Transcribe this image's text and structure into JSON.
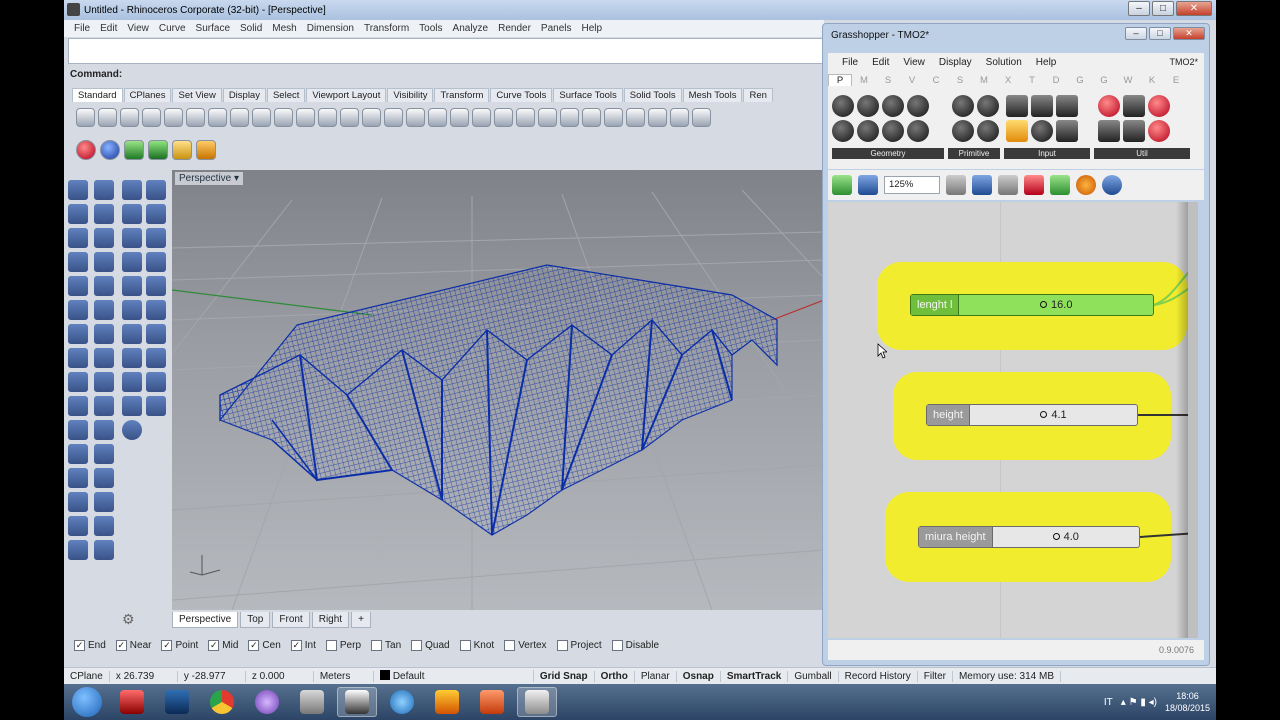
{
  "rhino": {
    "window_title": "Untitled - Rhinoceros Corporate (32-bit) - [Perspective]",
    "menu": [
      "File",
      "Edit",
      "View",
      "Curve",
      "Surface",
      "Solid",
      "Mesh",
      "Dimension",
      "Transform",
      "Tools",
      "Analyze",
      "Render",
      "Panels",
      "Help"
    ],
    "command_label": "Command:",
    "toolbar_tabs": [
      "Standard",
      "CPlanes",
      "Set View",
      "Display",
      "Select",
      "Viewport Layout",
      "Visibility",
      "Transform",
      "Curve Tools",
      "Surface Tools",
      "Solid Tools",
      "Mesh Tools",
      "Ren"
    ],
    "viewport_title": "Perspective",
    "viewport_tabs": [
      "Perspective",
      "Top",
      "Front",
      "Right"
    ],
    "viewport_add_tab": "+",
    "osnaps": [
      {
        "label": "End",
        "checked": true
      },
      {
        "label": "Near",
        "checked": true
      },
      {
        "label": "Point",
        "checked": true
      },
      {
        "label": "Mid",
        "checked": true
      },
      {
        "label": "Cen",
        "checked": true
      },
      {
        "label": "Int",
        "checked": true
      },
      {
        "label": "Perp",
        "checked": false
      },
      {
        "label": "Tan",
        "checked": false
      },
      {
        "label": "Quad",
        "checked": false
      },
      {
        "label": "Knot",
        "checked": false
      },
      {
        "label": "Vertex",
        "checked": false
      },
      {
        "label": "Project",
        "checked": false
      },
      {
        "label": "Disable",
        "checked": false
      }
    ],
    "status": {
      "cplane": "CPlane",
      "x": "x 26.739",
      "y": "y -28.977",
      "z": "z 0.000",
      "units": "Meters",
      "layer": "Default",
      "toggles": [
        "Grid Snap",
        "Ortho",
        "Planar",
        "Osnap",
        "SmartTrack",
        "Gumball",
        "Record History",
        "Filter"
      ],
      "memory": "Memory use: 314 MB"
    }
  },
  "grasshopper": {
    "title": "Grasshopper - TMO2*",
    "menu": [
      "File",
      "Edit",
      "View",
      "Display",
      "Solution",
      "Help"
    ],
    "document": "TMO2*",
    "tabs": [
      "P",
      "M",
      "S",
      "V",
      "C",
      "S",
      "M",
      "X",
      "T",
      "D",
      "G",
      "G",
      "W",
      "K",
      "E"
    ],
    "palette_groups": [
      "Geometry",
      "Primitive",
      "Input",
      "Util"
    ],
    "zoom": "125%",
    "sliders": [
      {
        "name": "lenght l",
        "value": "16.0"
      },
      {
        "name": "height",
        "value": "4.1"
      },
      {
        "name": "miura height",
        "value": "4.0"
      }
    ],
    "version": "0.9.0076"
  },
  "taskbar": {
    "lang": "IT",
    "time": "18:06",
    "date": "18/08/2015"
  },
  "colors": {
    "mesh_blue": "#0b2ea8",
    "group_yellow": "#f2ec2f",
    "slider_green": "#8fe05a"
  }
}
